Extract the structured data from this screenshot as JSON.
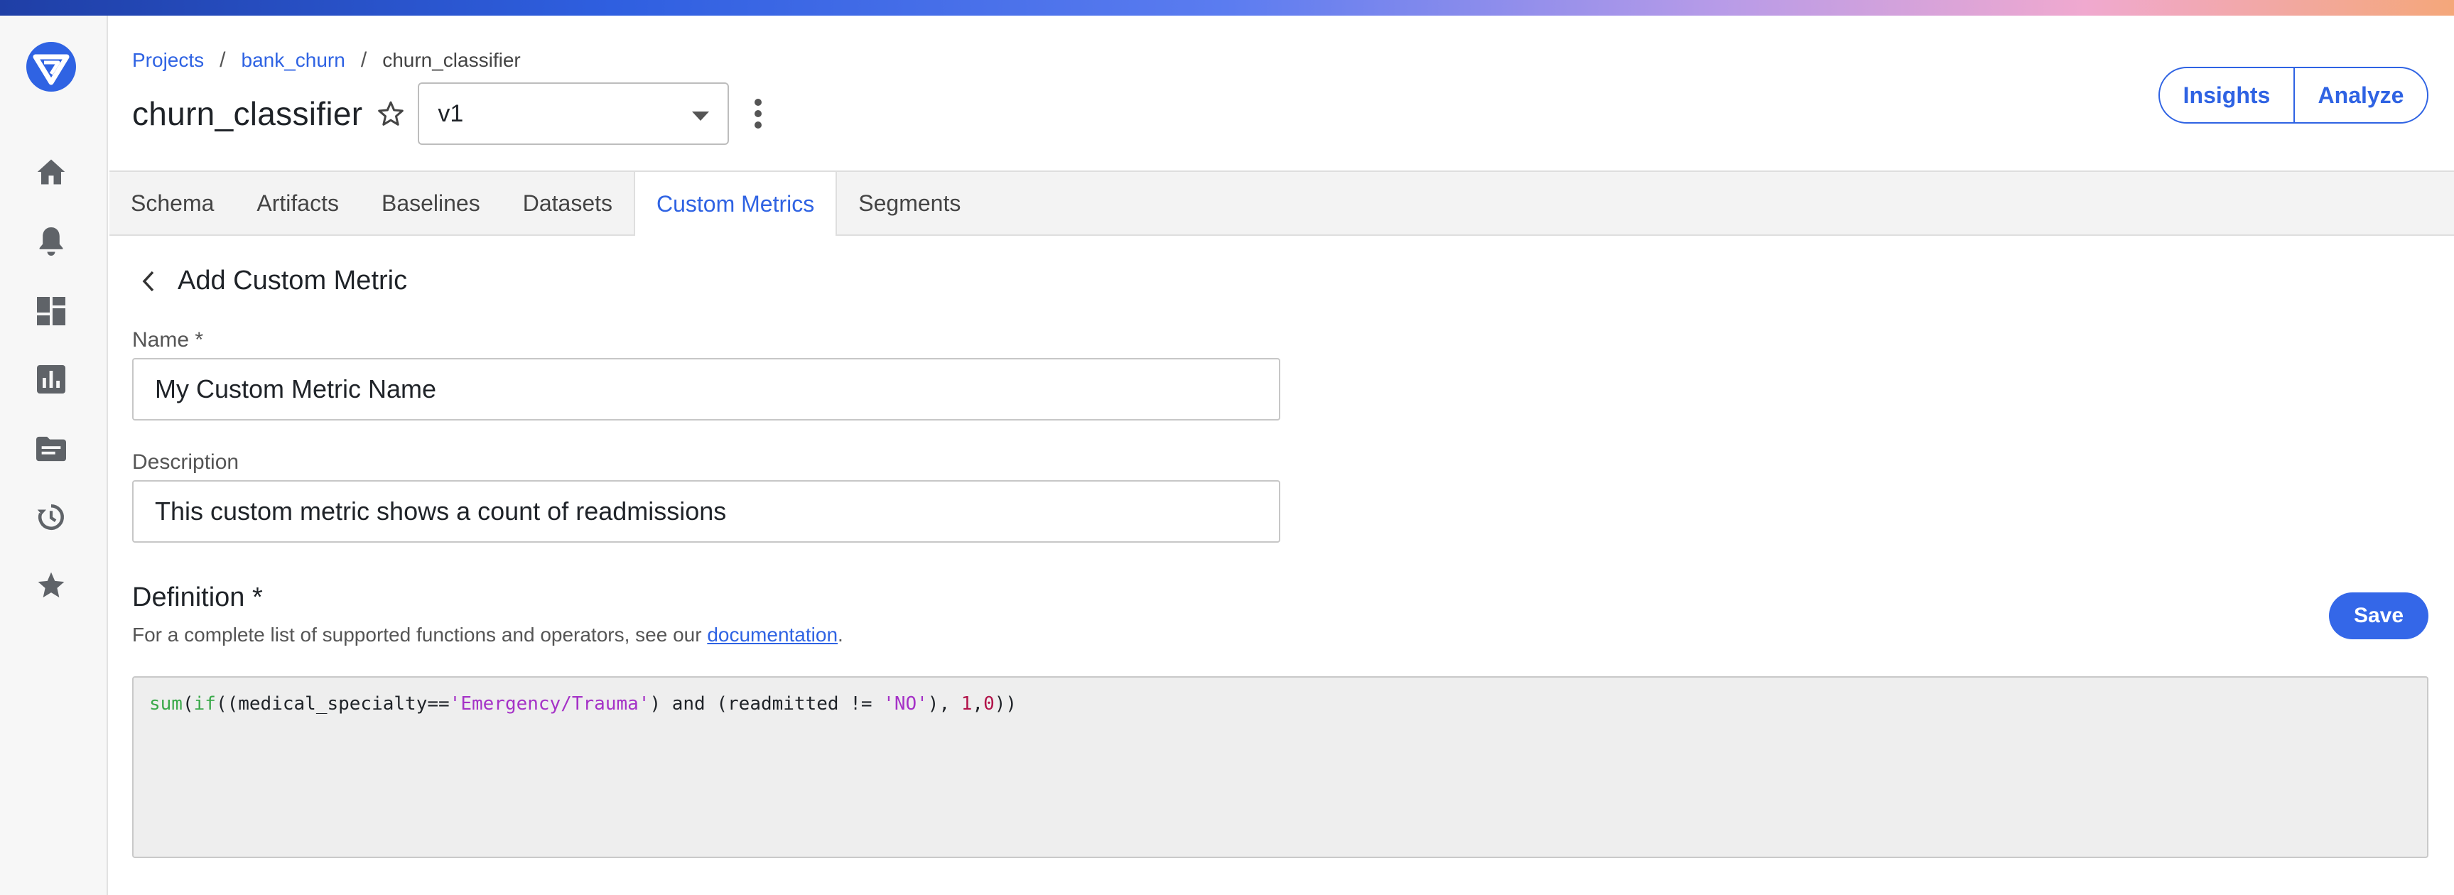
{
  "breadcrumb": {
    "projects": "Projects",
    "project": "bank_churn",
    "current": "churn_classifier",
    "separator": "/"
  },
  "model": {
    "title": "churn_classifier",
    "version": "v1"
  },
  "header_buttons": {
    "insights": "Insights",
    "analyze": "Analyze"
  },
  "tabs": [
    {
      "label": "Schema",
      "active": false
    },
    {
      "label": "Artifacts",
      "active": false
    },
    {
      "label": "Baselines",
      "active": false
    },
    {
      "label": "Datasets",
      "active": false
    },
    {
      "label": "Custom Metrics",
      "active": true
    },
    {
      "label": "Segments",
      "active": false
    }
  ],
  "form": {
    "heading": "Add Custom Metric",
    "name_label": "Name *",
    "name_value": "My Custom Metric Name",
    "description_label": "Description",
    "description_value": "This custom metric shows a count of readmissions",
    "definition_label": "Definition *",
    "definition_help_prefix": "For a complete list of supported functions and operators, see our ",
    "definition_help_link": "documentation",
    "definition_help_suffix": ".",
    "save_label": "Save",
    "code": {
      "fn1": "sum",
      "p1": "(",
      "fn2": "if",
      "p2": "((medical_specialty==",
      "str1": "'Emergency/Trauma'",
      "p3": ") and (readmitted != ",
      "str2": "'NO'",
      "p4": "), ",
      "num1": "1",
      "p5": ",",
      "num2": "0",
      "p6": "))"
    }
  },
  "sidebar": {
    "icons": [
      "home-icon",
      "bell-icon",
      "dashboard-icon",
      "chart-icon",
      "folder-icon",
      "history-icon",
      "star-icon"
    ]
  },
  "colors": {
    "accent": "#2f63e3",
    "save_button": "#3467e8",
    "code_function": "#3aa94a",
    "code_string": "#a532c7",
    "code_number": "#b2144a"
  }
}
